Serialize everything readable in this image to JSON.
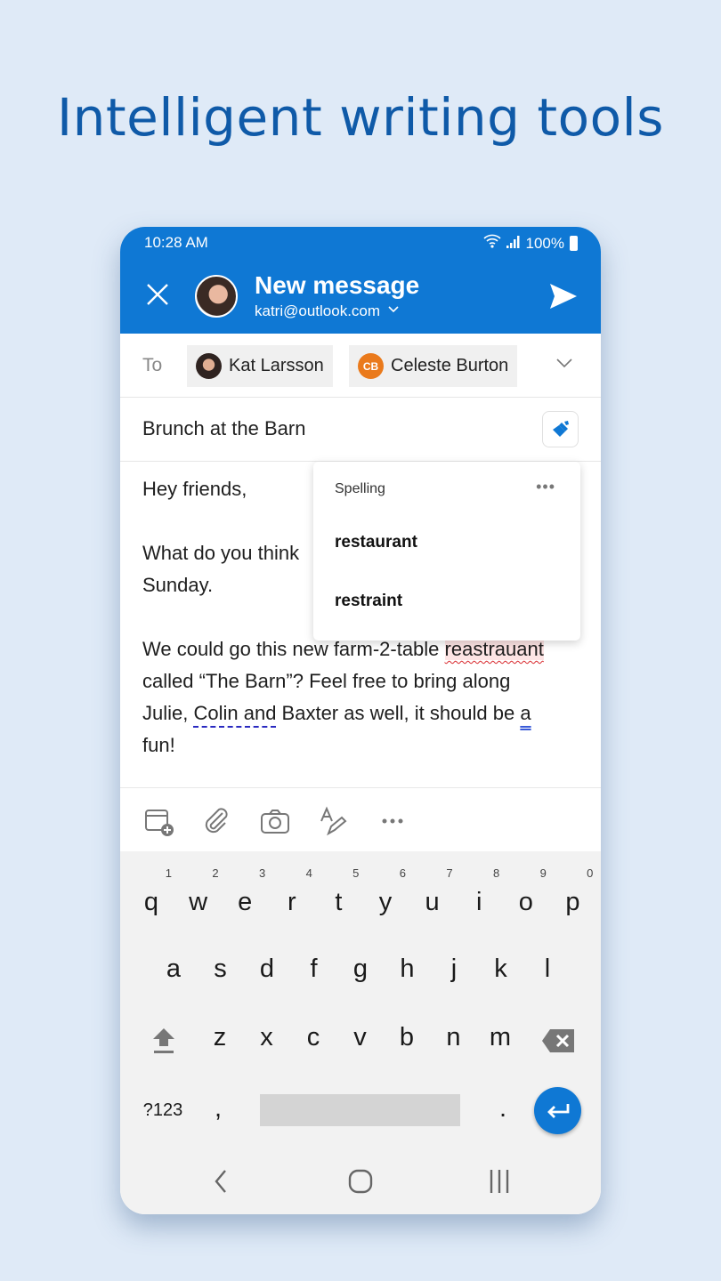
{
  "headline": "Intelligent writing tools",
  "status": {
    "time": "10:28 AM",
    "battery": "100%"
  },
  "header": {
    "title": "New message",
    "account": "katri@outlook.com"
  },
  "to": {
    "label": "To",
    "recipients": [
      {
        "name": "Kat Larsson"
      },
      {
        "name": "Celeste Burton",
        "initials": "CB",
        "color": "#ea7a1c"
      }
    ]
  },
  "subject": "Brunch at the Barn",
  "body": {
    "greeting": "Hey friends,",
    "line2": "What do you think",
    "line3": "Sunday.",
    "line4_pre": "We could go this new farm-2-table ",
    "line4_err": "reastrauant",
    "line5": "called “The Barn”? Feel free to bring along",
    "line6_a": "Julie, ",
    "line6_b": "Colin and",
    "line6_c": " Baxter as well, it should be ",
    "line6_d": "a",
    "line7": "fun!"
  },
  "spelling": {
    "header": "Spelling",
    "more": "•••",
    "suggestions": [
      "restaurant",
      "restraint"
    ]
  },
  "keyboard": {
    "row1": [
      "q",
      "w",
      "e",
      "r",
      "t",
      "y",
      "u",
      "i",
      "o",
      "p"
    ],
    "nums": [
      "1",
      "2",
      "3",
      "4",
      "5",
      "6",
      "7",
      "8",
      "9",
      "0"
    ],
    "row2": [
      "a",
      "s",
      "d",
      "f",
      "g",
      "h",
      "j",
      "k",
      "l"
    ],
    "row3": [
      "z",
      "x",
      "c",
      "v",
      "b",
      "n",
      "m"
    ],
    "symbols": "?123",
    "comma": ",",
    "period": "."
  },
  "colors": {
    "accent": "#0f78d4",
    "headline": "#0f5aa8",
    "background": "#dfeaf7"
  }
}
